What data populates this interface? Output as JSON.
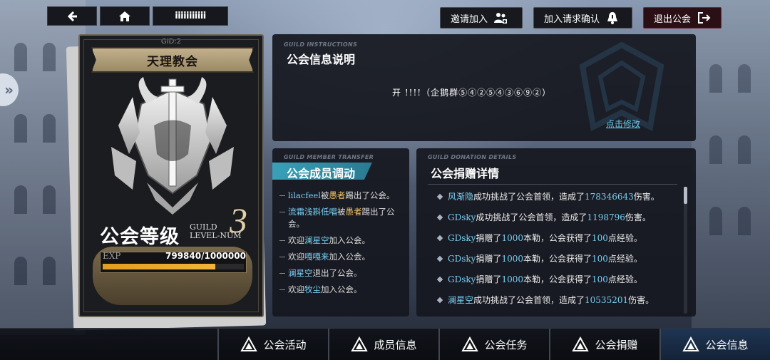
{
  "nav": {
    "page_title": "iiiiiiiiiii"
  },
  "actions": {
    "invite_label": "邀请加入",
    "request_confirm_label": "加入请求确认",
    "quit_label": "退出公会"
  },
  "guild": {
    "gid": "GID:2",
    "name": "天理教会",
    "level_label": "公会等级",
    "level_en_line1": "GUILD",
    "level_en_line2": "LEVEL-NUM",
    "level": "3",
    "exp_label": "EXP",
    "exp_value": "799840/1000000",
    "exp_fraction": 0.79984
  },
  "instructions": {
    "tag": "GUILD INSTRUCTIONS",
    "title": "公会信息说明",
    "text": "开 !!!!（企鹅群⑤④②⑤④③⑥⑨②）",
    "edit_link": "点击修改"
  },
  "transfer": {
    "tag": "GUILD MEMBER TRANSFER",
    "title": "公会成员调动",
    "entries": [
      {
        "a": "lilacfeel",
        "mid": "被",
        "b": "愚者",
        "end": "踢出了公会。"
      },
      {
        "a": "流霜浅斟低唱",
        "mid": "被",
        "b": "愚者",
        "end": "踢出了公会。"
      },
      {
        "pre": "欢迎",
        "a": "澜星空",
        "end": "加入公会。"
      },
      {
        "pre": "欢迎",
        "a": "嘎嘎来",
        "end": "加入公会。"
      },
      {
        "a": "澜星空",
        "end": "退出了公会。"
      },
      {
        "pre": "欢迎",
        "a": "牧尘",
        "end": "加入公会。"
      }
    ]
  },
  "donation": {
    "tag": "GUILD DONATION DETAILS",
    "title": "公会捐赠详情",
    "entries": [
      {
        "name": "风渐隐",
        "t1": "成功挑战了公会首领，造成了",
        "num": "178346643",
        "t2": "伤害。"
      },
      {
        "name": "GDsky",
        "t1": "成功挑战了公会首领，造成了",
        "num": "1198796",
        "t2": "伤害。"
      },
      {
        "name": "GDsky",
        "t1": "捐赠了",
        "num": "1000",
        "t2": "本勒，公会获得了",
        "num2": "100",
        "t3": "点经验。"
      },
      {
        "name": "GDsky",
        "t1": "捐赠了",
        "num": "1000",
        "t2": "本勒，公会获得了",
        "num2": "100",
        "t3": "点经验。"
      },
      {
        "name": "GDsky",
        "t1": "捐赠了",
        "num": "1000",
        "t2": "本勒，公会获得了",
        "num2": "100",
        "t3": "点经验。"
      },
      {
        "name": "澜星空",
        "t1": "成功挑战了公会首领，造成了",
        "num": "10535201",
        "t2": "伤害。"
      }
    ]
  },
  "bottom_nav": {
    "items": [
      {
        "label": "公会活动",
        "icon": "guild-emblem-icon"
      },
      {
        "label": "成员信息",
        "icon": "guild-emblem-icon"
      },
      {
        "label": "公会任务",
        "icon": "guild-emblem-icon"
      },
      {
        "label": "公会捐赠",
        "icon": "guild-emblem-icon"
      },
      {
        "label": "公会信息",
        "icon": "guild-emblem-icon",
        "active": true
      }
    ]
  },
  "colors": {
    "highlight_blue": "#79cff2",
    "highlight_gold": "#f0c060",
    "exp_bar": "#e39d1e",
    "quit_button_bg": "#2a0f15"
  }
}
